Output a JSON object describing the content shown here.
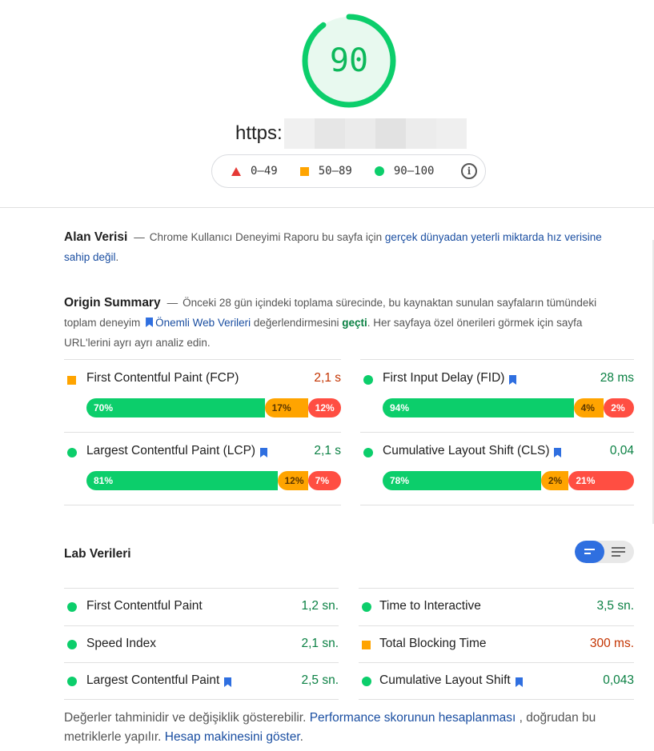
{
  "header": {
    "score": "90",
    "url": "https:",
    "legend": [
      {
        "label": "0–49",
        "shape": "triangle",
        "color": "#e53935"
      },
      {
        "label": "50–89",
        "shape": "square",
        "color": "#ffa400"
      },
      {
        "label": "90–100",
        "shape": "circle",
        "color": "#0cce6b"
      }
    ],
    "info_icon": "info-icon"
  },
  "field": {
    "title": "Alan Verisi",
    "dash": "—",
    "text_before": "Chrome Kullanıcı Deneyimi Raporu bu sayfa için",
    "link": "gerçek dünyadan yeterli miktarda hız verisine sahip değil",
    "text_after": "."
  },
  "origin": {
    "title": "Origin Summary",
    "dash": "—",
    "text1": "Önceki 28 gün içindeki toplama sürecinde, bu kaynaktan sunulan sayfaların tümündeki toplam deneyim",
    "link": "Önemli Web Verileri",
    "text2": "değerlendirmesini",
    "status": "geçti",
    "text3": ". Her sayfaya özel önerileri görmek için sayfa URL'lerini ayrı ayrı analiz edin."
  },
  "field_metrics": [
    {
      "name": "First Contentful Paint (FCP)",
      "value": "2,1 s",
      "status": "average",
      "bookmark": false,
      "dist": [
        {
          "label": "70%",
          "pct": 70
        },
        {
          "label": "17%",
          "pct": 17
        },
        {
          "label": "12%",
          "pct": 13
        }
      ]
    },
    {
      "name": "First Input Delay (FID)",
      "value": "28 ms",
      "status": "good",
      "bookmark": true,
      "dist": [
        {
          "label": "94%",
          "pct": 76
        },
        {
          "label": "4%",
          "pct": 12
        },
        {
          "label": "2%",
          "pct": 12
        }
      ]
    },
    {
      "name": "Largest Contentful Paint (LCP)",
      "value": "2,1 s",
      "status": "good",
      "bookmark": true,
      "dist": [
        {
          "label": "81%",
          "pct": 75
        },
        {
          "label": "12%",
          "pct": 12
        },
        {
          "label": "7%",
          "pct": 13
        }
      ]
    },
    {
      "name": "Cumulative Layout Shift (CLS)",
      "value": "0,04",
      "status": "good",
      "bookmark": true,
      "dist": [
        {
          "label": "78%",
          "pct": 63
        },
        {
          "label": "2%",
          "pct": 11
        },
        {
          "label": "21%",
          "pct": 26
        }
      ]
    }
  ],
  "lab": {
    "title": "Lab Verileri",
    "metrics": [
      {
        "name": "First Contentful Paint",
        "value": "1,2 sn.",
        "status": "good",
        "bookmark": false
      },
      {
        "name": "Time to Interactive",
        "value": "3,5 sn.",
        "status": "good",
        "bookmark": false
      },
      {
        "name": "Speed Index",
        "value": "2,1 sn.",
        "status": "good",
        "bookmark": false
      },
      {
        "name": "Total Blocking Time",
        "value": "300 ms.",
        "status": "average",
        "bookmark": false
      },
      {
        "name": "Largest Contentful Paint",
        "value": "2,5 sn.",
        "status": "good",
        "bookmark": true
      },
      {
        "name": "Cumulative Layout Shift",
        "value": "0,043",
        "status": "good",
        "bookmark": true
      }
    ]
  },
  "footer": {
    "text1": "Değerler tahminidir ve değişiklik gösterebilir.",
    "link1": "Performance skorunun hesaplanması",
    "text2": ", doğrudan bu metriklerle yapılır.",
    "link2": "Hesap makinesini göster",
    "text3": "."
  },
  "colors": {
    "good": "#0cce6b",
    "good_text": "#0a8043",
    "average": "#ffa400",
    "average_text": "#c33300",
    "poor": "#ff4e42",
    "link": "#1a4ea1",
    "toggle_active": "#2f6fe0"
  }
}
